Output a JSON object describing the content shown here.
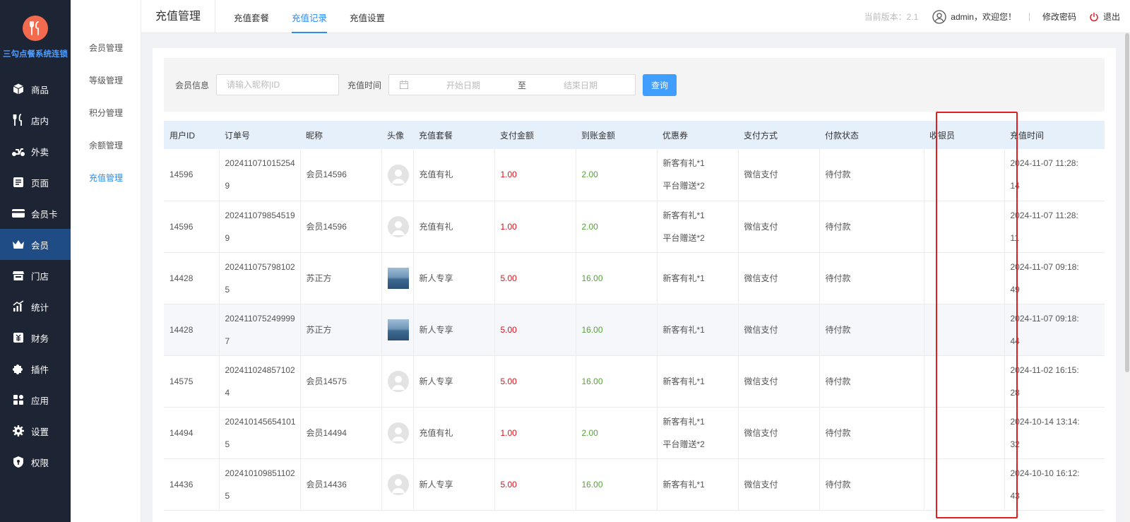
{
  "brand": {
    "name": "三勾点餐系统连锁"
  },
  "sidebar": {
    "items": [
      {
        "label": "商品",
        "icon": "box-icon"
      },
      {
        "label": "店内",
        "icon": "fork-knife-icon"
      },
      {
        "label": "外卖",
        "icon": "scooter-icon"
      },
      {
        "label": "页面",
        "icon": "page-icon"
      },
      {
        "label": "会员卡",
        "icon": "card-icon"
      },
      {
        "label": "会员",
        "icon": "crown-icon",
        "active": true
      },
      {
        "label": "门店",
        "icon": "store-icon"
      },
      {
        "label": "统计",
        "icon": "chart-icon"
      },
      {
        "label": "财务",
        "icon": "finance-icon"
      },
      {
        "label": "插件",
        "icon": "puzzle-icon"
      },
      {
        "label": "应用",
        "icon": "apps-icon"
      },
      {
        "label": "设置",
        "icon": "gear-icon"
      },
      {
        "label": "权限",
        "icon": "shield-icon"
      }
    ]
  },
  "subnav": {
    "items": [
      {
        "label": "会员管理"
      },
      {
        "label": "等级管理"
      },
      {
        "label": "积分管理"
      },
      {
        "label": "余额管理"
      },
      {
        "label": "充值管理",
        "active": true
      }
    ]
  },
  "header": {
    "title": "充值管理",
    "tabs": [
      {
        "label": "充值套餐"
      },
      {
        "label": "充值记录",
        "active": true
      },
      {
        "label": "充值设置"
      }
    ],
    "version": "当前版本：2.1",
    "user": "admin，欢迎您！",
    "change_password": "修改密码",
    "logout": "退出"
  },
  "filter": {
    "member_label": "会员信息",
    "member_placeholder": "请输入昵称|ID",
    "time_label": "充值时间",
    "start_placeholder": "开始日期",
    "separator": "至",
    "end_placeholder": "结束日期",
    "query_button": "查询"
  },
  "table": {
    "columns": [
      "用户ID",
      "订单号",
      "昵称",
      "头像",
      "充值套餐",
      "支付金额",
      "到账金额",
      "优惠券",
      "支付方式",
      "付款状态",
      "收银员",
      "充值时间"
    ],
    "rows": [
      {
        "uid": "14596",
        "order1": "202411071015254",
        "order2": "9",
        "nick": "会员14596",
        "avatar": "default",
        "plan": "充值有礼",
        "pay": "1.00",
        "arrive": "2.00",
        "coupon1": "新客有礼*1",
        "coupon2": "平台赠送*2",
        "method": "微信支付",
        "status": "待付款",
        "cashier": "",
        "time1": "2024-11-07 11:28:",
        "time2": "14"
      },
      {
        "uid": "14596",
        "order1": "202411079854519",
        "order2": "9",
        "nick": "会员14596",
        "avatar": "default",
        "plan": "充值有礼",
        "pay": "1.00",
        "arrive": "2.00",
        "coupon1": "新客有礼*1",
        "coupon2": "平台赠送*2",
        "method": "微信支付",
        "status": "待付款",
        "cashier": "",
        "time1": "2024-11-07 11:28:",
        "time2": "11"
      },
      {
        "uid": "14428",
        "order1": "202411075798102",
        "order2": "5",
        "nick": "苏正方",
        "avatar": "photo",
        "plan": "新人专享",
        "pay": "5.00",
        "arrive": "16.00",
        "coupon1": "新客有礼*1",
        "coupon2": "",
        "method": "微信支付",
        "status": "待付款",
        "cashier": "",
        "time1": "2024-11-07 09:18:",
        "time2": "49"
      },
      {
        "uid": "14428",
        "order1": "202411075249999",
        "order2": "7",
        "nick": "苏正方",
        "avatar": "photo",
        "plan": "新人专享",
        "pay": "5.00",
        "arrive": "16.00",
        "coupon1": "新客有礼*1",
        "coupon2": "",
        "method": "微信支付",
        "status": "待付款",
        "cashier": "",
        "time1": "2024-11-07 09:18:",
        "time2": "44"
      },
      {
        "uid": "14575",
        "order1": "202411024857102",
        "order2": "4",
        "nick": "会员14575",
        "avatar": "default",
        "plan": "新人专享",
        "pay": "5.00",
        "arrive": "16.00",
        "coupon1": "新客有礼*1",
        "coupon2": "",
        "method": "微信支付",
        "status": "待付款",
        "cashier": "",
        "time1": "2024-11-02 16:15:",
        "time2": "28"
      },
      {
        "uid": "14494",
        "order1": "202410145654101",
        "order2": "5",
        "nick": "会员14494",
        "avatar": "default",
        "plan": "充值有礼",
        "pay": "1.00",
        "arrive": "2.00",
        "coupon1": "新客有礼*1",
        "coupon2": "平台赠送*2",
        "method": "微信支付",
        "status": "待付款",
        "cashier": "",
        "time1": "2024-10-14 13:14:",
        "time2": "32"
      },
      {
        "uid": "14436",
        "order1": "202410109851102",
        "order2": "5",
        "nick": "会员14436",
        "avatar": "default",
        "plan": "新人专享",
        "pay": "5.00",
        "arrive": "16.00",
        "coupon1": "新客有礼*1",
        "coupon2": "",
        "method": "微信支付",
        "status": "待付款",
        "cashier": "",
        "time1": "2024-10-10 16:12:",
        "time2": "43"
      }
    ]
  },
  "colors": {
    "accent": "#2d8cf0",
    "sidebar_bg": "#1d2434",
    "highlight": "#e02020",
    "pay_amount": "#e0101a",
    "arrive_amount": "#54a534"
  }
}
